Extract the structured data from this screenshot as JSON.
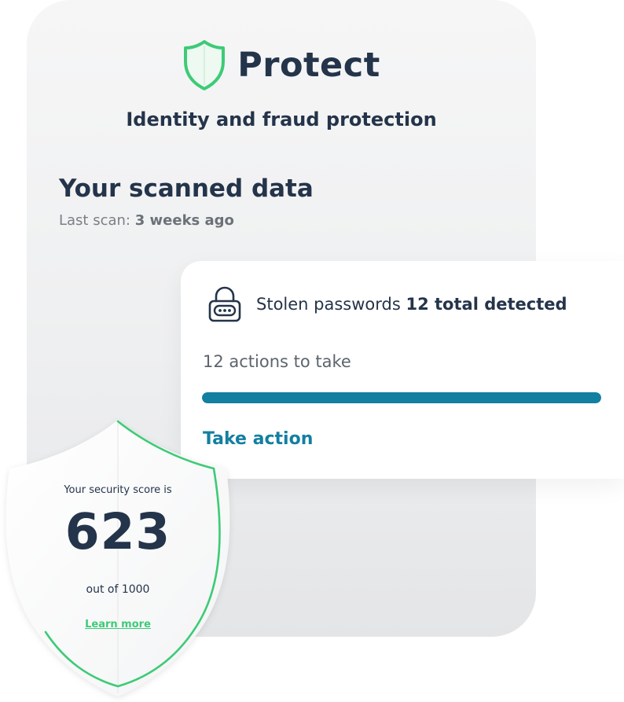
{
  "brand": {
    "name": "Protect",
    "subtitle": "Identity and fraud protection",
    "accent_color": "#3ccb76",
    "text_color": "#24344a"
  },
  "scan": {
    "title": "Your scanned data",
    "last_scan_label": "Last scan:",
    "last_scan_value": "3 weeks ago"
  },
  "card": {
    "icon": "lock-icon",
    "item_label": "Stolen passwords",
    "detected_text": "12 total detected",
    "actions_text": "12 actions to take",
    "progress": 1.0,
    "progress_color": "#137fa1",
    "action_label": "Take action"
  },
  "score": {
    "label": "Your security score is",
    "value": "623",
    "out_of": "out of 1000",
    "learn_more": "Learn more"
  }
}
